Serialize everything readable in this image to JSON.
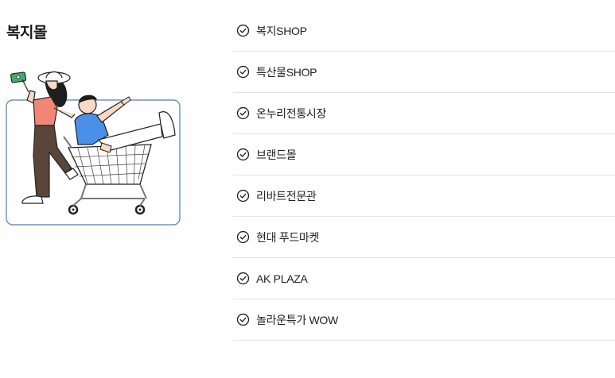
{
  "section": {
    "title": "복지몰"
  },
  "menu": {
    "items": [
      {
        "label": "복지SHOP",
        "icon": "check-circle-icon"
      },
      {
        "label": "특산물SHOP",
        "icon": "check-circle-icon"
      },
      {
        "label": "온누리전통시장",
        "icon": "check-circle-icon"
      },
      {
        "label": "브랜드몰",
        "icon": "check-circle-icon"
      },
      {
        "label": "리바트전문관",
        "icon": "check-circle-icon"
      },
      {
        "label": "현대 푸드마켓",
        "icon": "check-circle-icon"
      },
      {
        "label": "AK PLAZA",
        "icon": "check-circle-icon"
      },
      {
        "label": "놀라운특가 WOW",
        "icon": "check-circle-icon"
      }
    ]
  },
  "colors": {
    "frame_border": "#4a7fc0",
    "accent_shirt_woman": "#f08775",
    "accent_shirt_man": "#4a8fe8",
    "banknote": "#3fae6c"
  }
}
